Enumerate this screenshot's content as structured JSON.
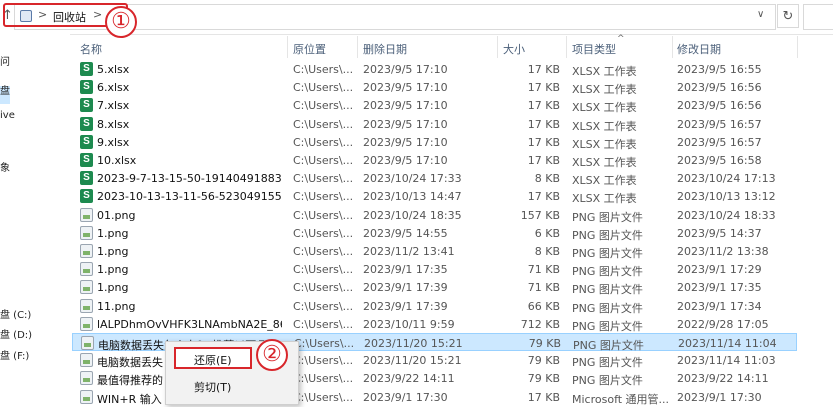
{
  "address": {
    "crumb": "回收站",
    "sep": ">",
    "up_glyph": "↑",
    "dropdown_glyph": "∨",
    "refresh_glyph": "↻"
  },
  "annotations": {
    "marker1": "①",
    "marker2": "②",
    "color": "#d8262b"
  },
  "nav": {
    "items": [
      "问",
      "盘",
      "ive",
      "象",
      "盘 (C:)",
      "盘 (D:)",
      "盘 (F:)"
    ]
  },
  "columns": {
    "name": "名称",
    "location": "原位置",
    "deleted": "删除日期",
    "size": "大小",
    "type": "项目类型",
    "modified": "修改日期",
    "sort_caret": "^"
  },
  "files": [
    {
      "name": "5.xlsx",
      "location": "C:\\Users\\...",
      "deleted": "2023/9/5 17:10",
      "size": "17 KB",
      "type": "XLSX 工作表",
      "modified": "2023/9/5 16:55",
      "icon": "xlsx-icon"
    },
    {
      "name": "6.xlsx",
      "location": "C:\\Users\\...",
      "deleted": "2023/9/5 17:10",
      "size": "17 KB",
      "type": "XLSX 工作表",
      "modified": "2023/9/5 16:56",
      "icon": "xlsx-icon"
    },
    {
      "name": "7.xlsx",
      "location": "C:\\Users\\...",
      "deleted": "2023/9/5 17:10",
      "size": "17 KB",
      "type": "XLSX 工作表",
      "modified": "2023/9/5 16:56",
      "icon": "xlsx-icon"
    },
    {
      "name": "8.xlsx",
      "location": "C:\\Users\\...",
      "deleted": "2023/9/5 17:10",
      "size": "17 KB",
      "type": "XLSX 工作表",
      "modified": "2023/9/5 16:57",
      "icon": "xlsx-icon"
    },
    {
      "name": "9.xlsx",
      "location": "C:\\Users\\...",
      "deleted": "2023/9/5 17:10",
      "size": "17 KB",
      "type": "XLSX 工作表",
      "modified": "2023/9/5 16:57",
      "icon": "xlsx-icon"
    },
    {
      "name": "10.xlsx",
      "location": "C:\\Users\\...",
      "deleted": "2023/9/5 17:10",
      "size": "17 KB",
      "type": "XLSX 工作表",
      "modified": "2023/9/5 16:58",
      "icon": "xlsx-icon"
    },
    {
      "name": "2023-9-7-13-15-50-191404918837...",
      "location": "C:\\Users\\...",
      "deleted": "2023/10/24 17:33",
      "size": "8 KB",
      "type": "XLSX 工作表",
      "modified": "2023/10/24 17:13",
      "icon": "xlsx-icon"
    },
    {
      "name": "2023-10-13-13-11-56-5230491553...",
      "location": "C:\\Users\\...",
      "deleted": "2023/10/13 14:47",
      "size": "17 KB",
      "type": "XLSX 工作表",
      "modified": "2023/10/13 13:12",
      "icon": "xlsx-icon"
    },
    {
      "name": "01.png",
      "location": "C:\\Users\\...",
      "deleted": "2023/10/24 18:35",
      "size": "157 KB",
      "type": "PNG 图片文件",
      "modified": "2023/10/24 18:33",
      "icon": "png-icon"
    },
    {
      "name": "1.png",
      "location": "C:\\Users\\...",
      "deleted": "2023/9/5 14:55",
      "size": "6 KB",
      "type": "PNG 图片文件",
      "modified": "2023/9/5 14:37",
      "icon": "png-icon"
    },
    {
      "name": "1.png",
      "location": "C:\\Users\\...",
      "deleted": "2023/11/2 13:41",
      "size": "8 KB",
      "type": "PNG 图片文件",
      "modified": "2023/11/2 13:38",
      "icon": "png-icon"
    },
    {
      "name": "1.png",
      "location": "C:\\Users\\...",
      "deleted": "2023/9/1 17:35",
      "size": "71 KB",
      "type": "PNG 图片文件",
      "modified": "2023/9/1 17:29",
      "icon": "png-icon"
    },
    {
      "name": "1.png",
      "location": "C:\\Users\\...",
      "deleted": "2023/9/1 17:39",
      "size": "71 KB",
      "type": "PNG 图片文件",
      "modified": "2023/9/1 17:35",
      "icon": "png-icon"
    },
    {
      "name": "11.png",
      "location": "C:\\Users\\...",
      "deleted": "2023/9/1 17:39",
      "size": "66 KB",
      "type": "PNG 图片文件",
      "modified": "2023/9/1 17:34",
      "icon": "png-icon"
    },
    {
      "name": "lALPDhmOvVHFK3LNAmbNA2E_86...",
      "location": "C:\\Users\\...",
      "deleted": "2023/10/11 9:59",
      "size": "712 KB",
      "type": "PNG 图片文件",
      "modified": "2022/9/28 17:05",
      "icon": "png-icon"
    },
    {
      "name": "电脑数据丢失怎么办？(推荐以下几种...",
      "location": "C:\\Users\\...",
      "deleted": "2023/11/20 15:21",
      "size": "79 KB",
      "type": "PNG 图片文件",
      "modified": "2023/11/14 11:04",
      "icon": "png-icon",
      "selected": true
    },
    {
      "name": "电脑数据丢失",
      "location": "C:\\Users\\...",
      "deleted": "2023/11/20 15:21",
      "size": "79 KB",
      "type": "PNG 图片文件",
      "modified": "2023/11/14 11:03",
      "icon": "png-icon"
    },
    {
      "name": "最值得推荐的",
      "location": "C:\\Users\\...",
      "deleted": "2023/9/22 14:11",
      "size": "79 KB",
      "type": "PNG 图片文件",
      "modified": "2023/9/22 14:11",
      "icon": "png-icon"
    },
    {
      "name": "WIN+R 输入",
      "location": "C:\\Users\\...",
      "deleted": "2023/9/1 17:30",
      "size": "17 KB",
      "type": "Microsoft 通用管...",
      "modified": "2023/9/1 17:30",
      "icon": "png-icon"
    }
  ],
  "context_menu": {
    "restore": "还原(E)",
    "cut": "剪切(T)"
  }
}
